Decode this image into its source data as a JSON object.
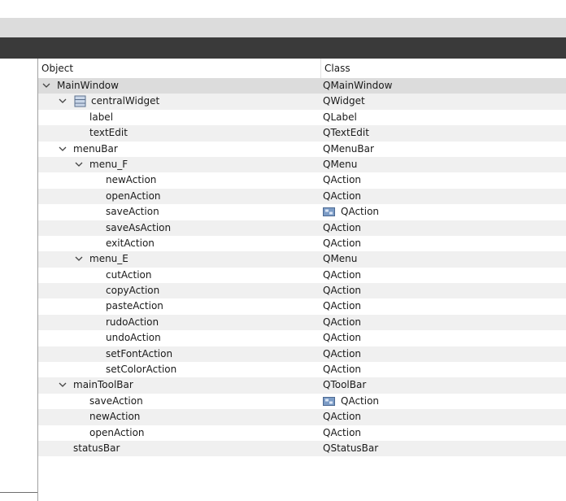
{
  "header": {
    "object_col": "Object",
    "class_col": "Class"
  },
  "rows": [
    {
      "name": "MainWindow",
      "cls": "QMainWindow"
    },
    {
      "name": "centralWidget",
      "cls": "QWidget"
    },
    {
      "name": "label",
      "cls": "QLabel"
    },
    {
      "name": "textEdit",
      "cls": "QTextEdit"
    },
    {
      "name": "menuBar",
      "cls": "QMenuBar"
    },
    {
      "name": "menu_F",
      "cls": "QMenu"
    },
    {
      "name": "newAction",
      "cls": "QAction"
    },
    {
      "name": "openAction",
      "cls": "QAction"
    },
    {
      "name": "saveAction",
      "cls": "QAction"
    },
    {
      "name": "saveAsAction",
      "cls": "QAction"
    },
    {
      "name": "exitAction",
      "cls": "QAction"
    },
    {
      "name": "menu_E",
      "cls": "QMenu"
    },
    {
      "name": "cutAction",
      "cls": "QAction"
    },
    {
      "name": "copyAction",
      "cls": "QAction"
    },
    {
      "name": "pasteAction",
      "cls": "QAction"
    },
    {
      "name": "rudoAction",
      "cls": "QAction"
    },
    {
      "name": "undoAction",
      "cls": "QAction"
    },
    {
      "name": "setFontAction",
      "cls": "QAction"
    },
    {
      "name": "setColorAction",
      "cls": "QAction"
    },
    {
      "name": "mainToolBar",
      "cls": "QToolBar"
    },
    {
      "name": "saveAction",
      "cls": "QAction"
    },
    {
      "name": "newAction",
      "cls": "QAction"
    },
    {
      "name": "openAction",
      "cls": "QAction"
    },
    {
      "name": "statusBar",
      "cls": "QStatusBar"
    }
  ]
}
